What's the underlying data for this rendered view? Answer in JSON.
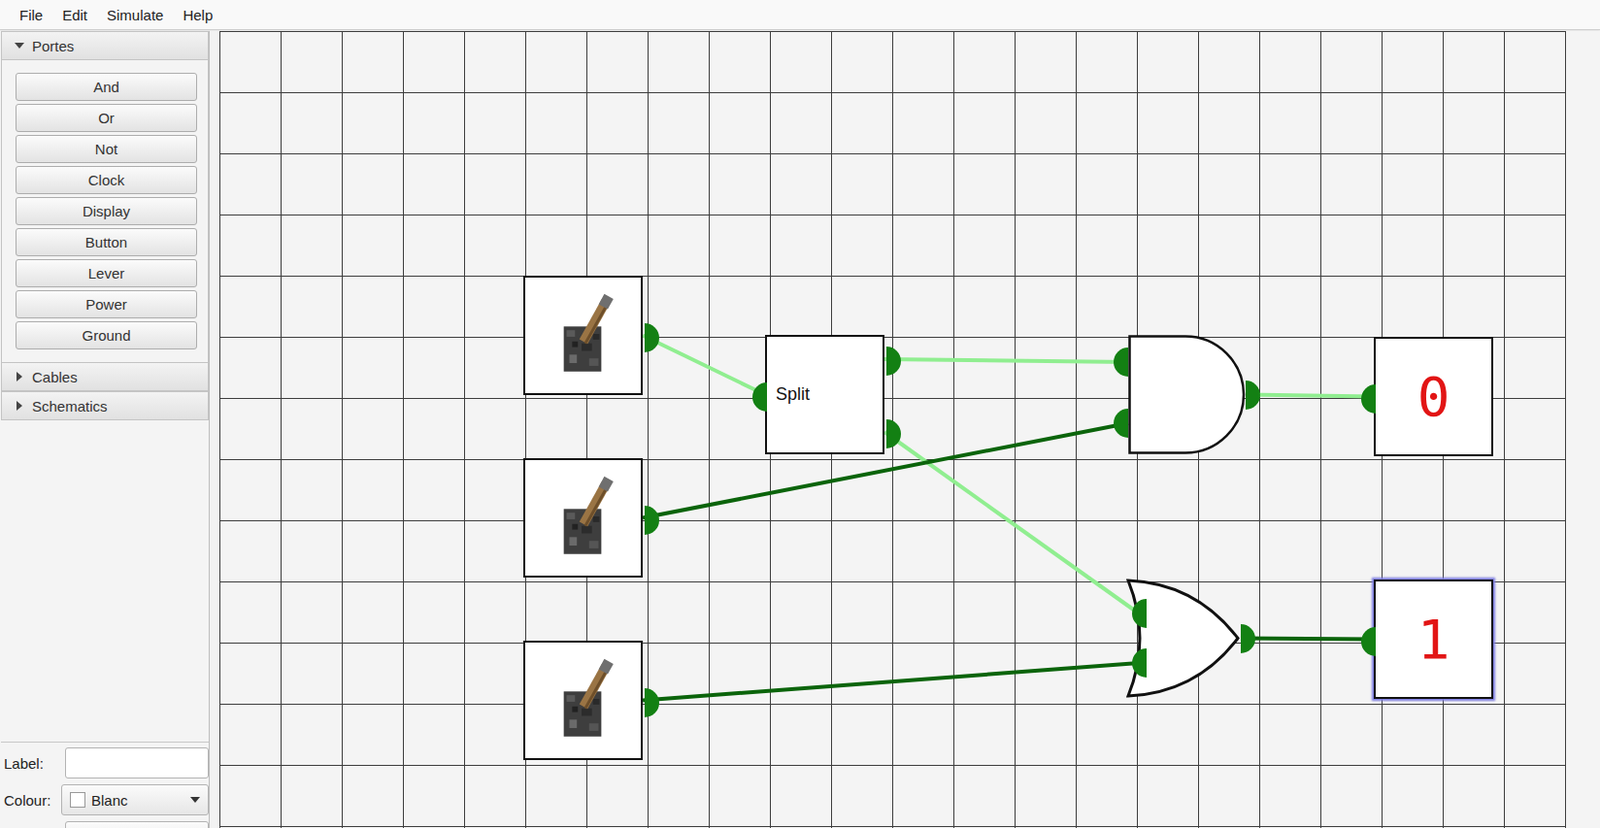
{
  "menu": [
    {
      "label": "File"
    },
    {
      "label": "Edit"
    },
    {
      "label": "Simulate"
    },
    {
      "label": "Help"
    }
  ],
  "sidebar": {
    "sections": [
      {
        "label": "Portes",
        "expanded": true,
        "items": [
          "And",
          "Or",
          "Not",
          "Clock",
          "Display",
          "Button",
          "Lever",
          "Power",
          "Ground"
        ]
      },
      {
        "label": "Cables",
        "expanded": false,
        "items": []
      },
      {
        "label": "Schematics",
        "expanded": false,
        "items": []
      }
    ]
  },
  "properties": {
    "label": {
      "caption": "Label:",
      "value": ""
    },
    "colour": {
      "caption": "Colour:",
      "value": "Blanc",
      "swatch": "#ffffff"
    }
  },
  "canvas": {
    "components": [
      {
        "kind": "lever"
      },
      {
        "kind": "lever"
      },
      {
        "kind": "lever"
      },
      {
        "kind": "split",
        "label": "Split"
      },
      {
        "kind": "and"
      },
      {
        "kind": "or"
      },
      {
        "kind": "display",
        "value": "0",
        "selected": false
      },
      {
        "kind": "display",
        "value": "1",
        "selected": true
      }
    ],
    "wires": [
      {
        "on": false
      },
      {
        "on": false
      },
      {
        "on": false
      },
      {
        "on": true
      },
      {
        "on": true
      },
      {
        "on": false
      },
      {
        "on": true
      }
    ]
  }
}
